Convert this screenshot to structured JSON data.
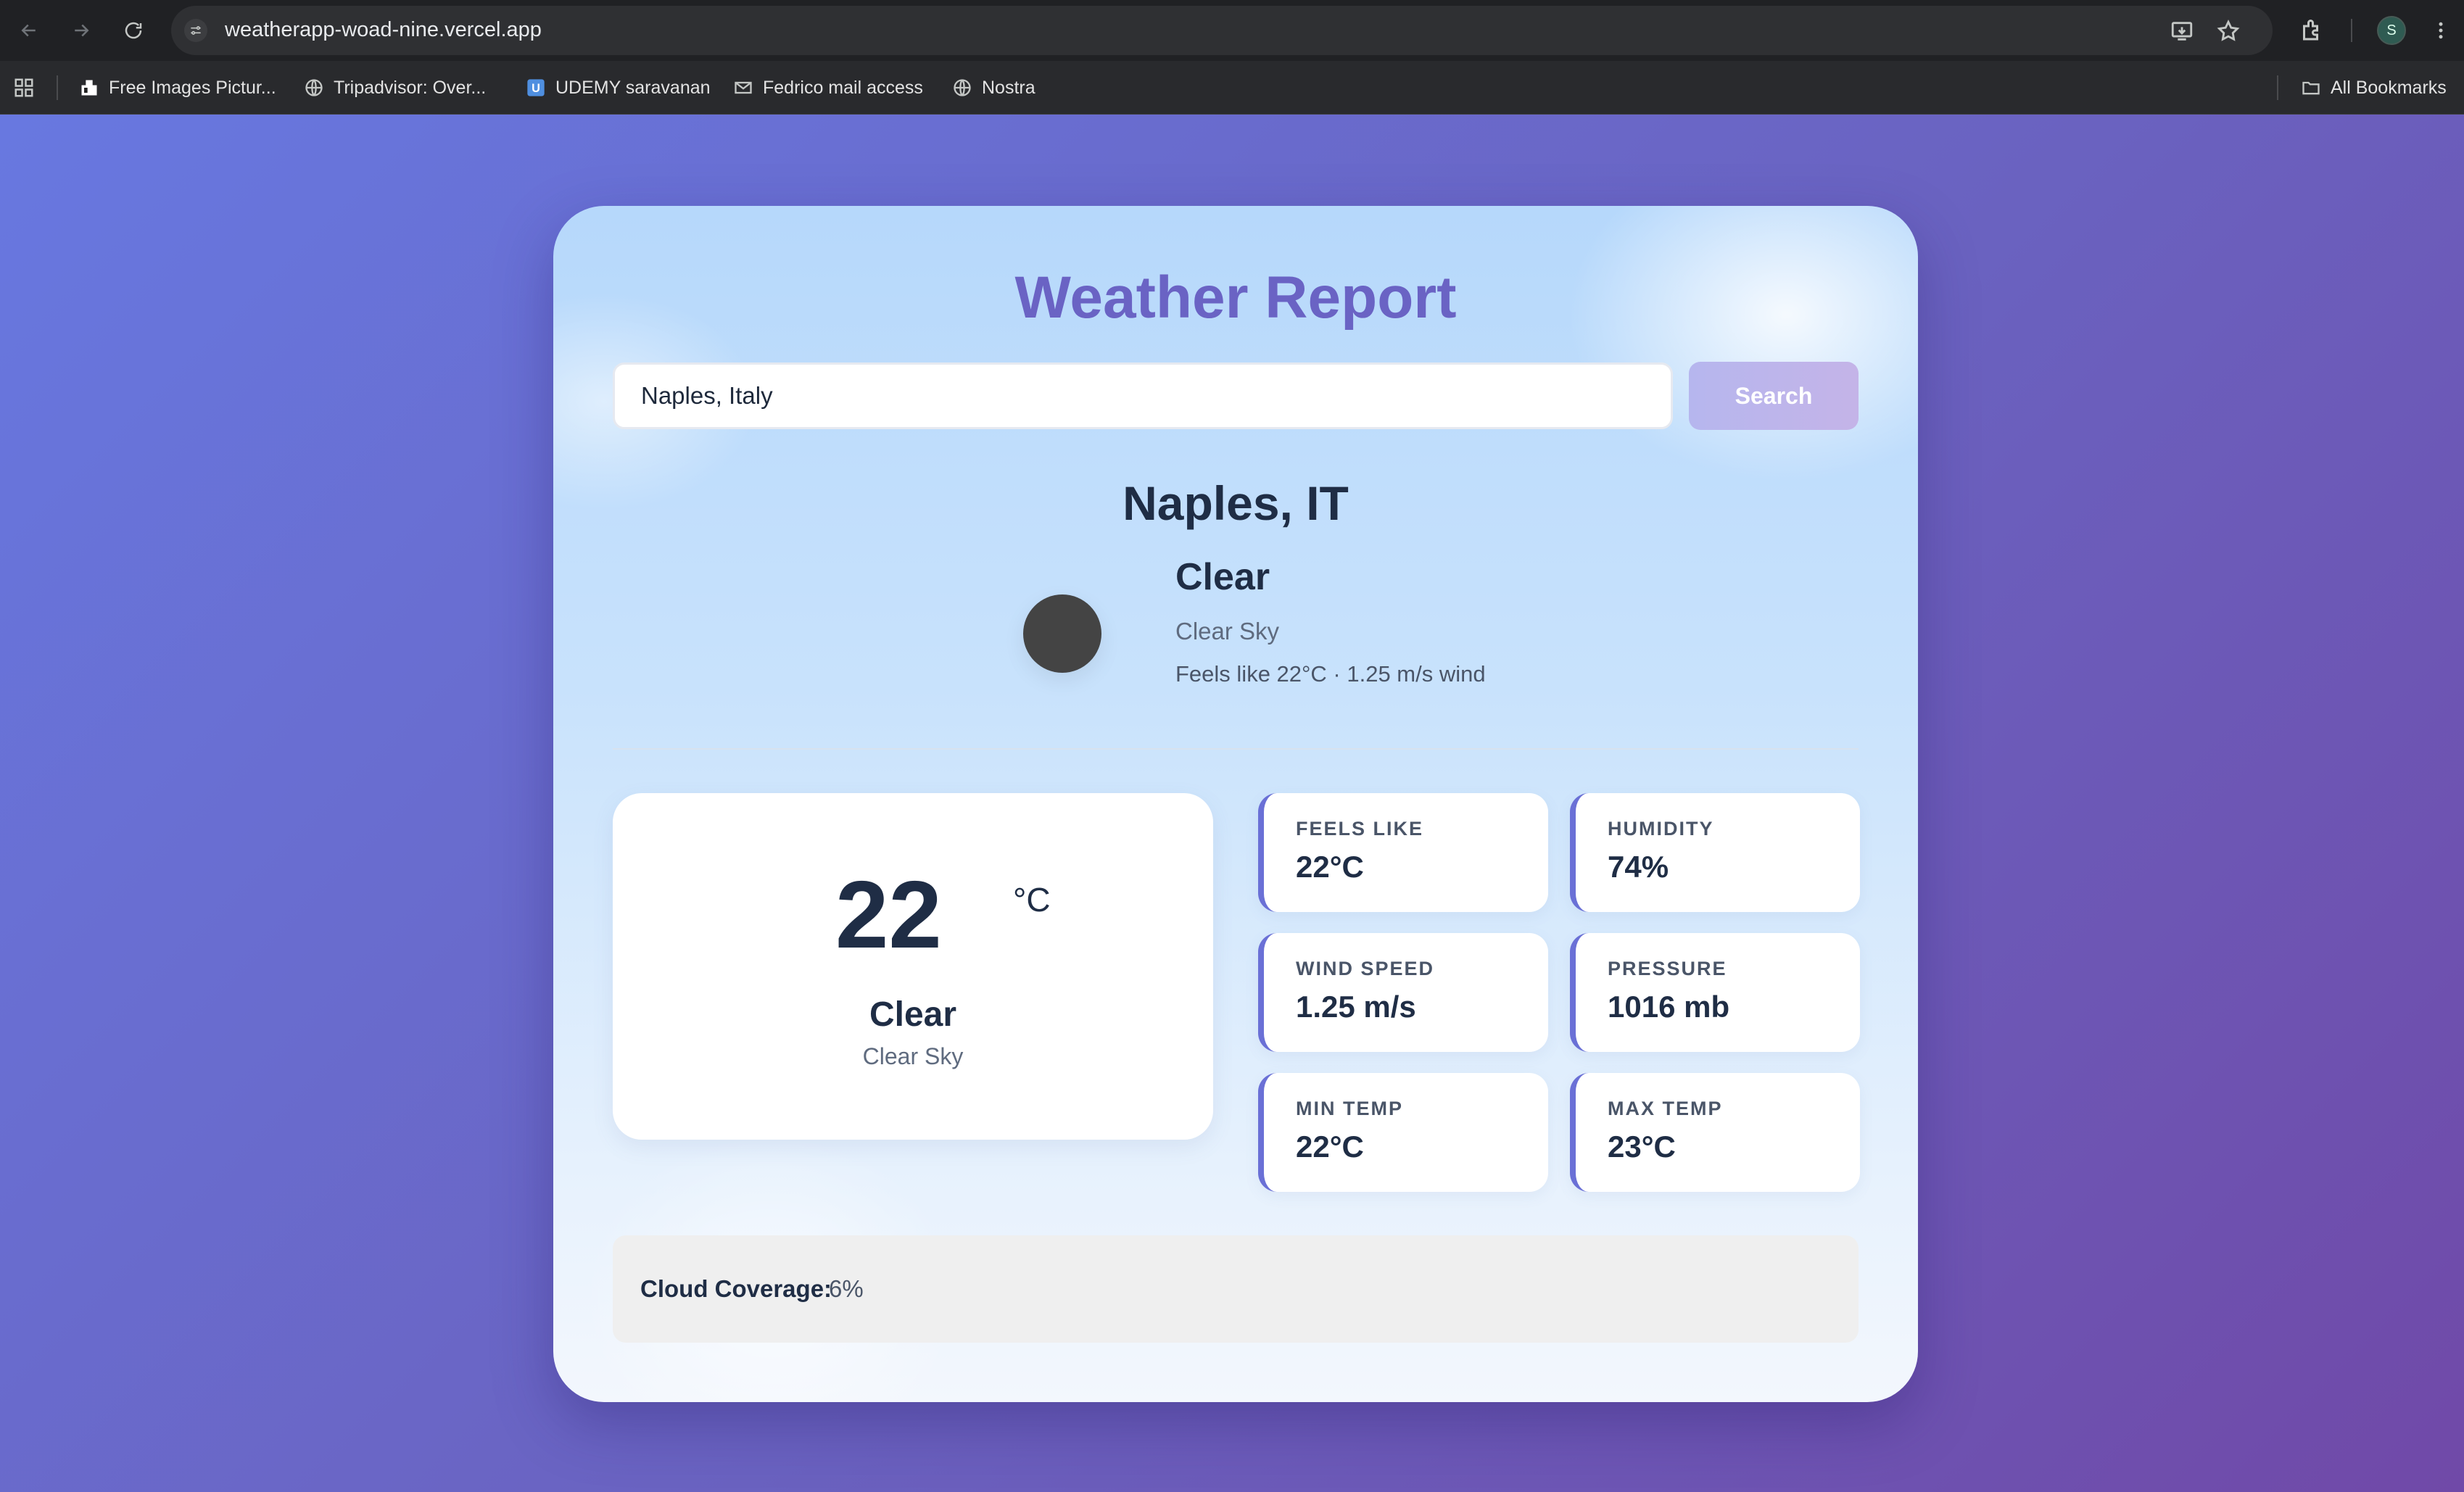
{
  "browser": {
    "url": "weatherapp-woad-nine.vercel.app",
    "profile_initial": "S",
    "bookmarks": [
      {
        "label": "Free Images Pictur...",
        "icon": "image-site-icon"
      },
      {
        "label": "Tripadvisor: Over...",
        "icon": "globe-icon"
      },
      {
        "label": "UDEMY saravanan",
        "icon": "udemy-icon"
      },
      {
        "label": "Fedrico mail access",
        "icon": "mail-icon"
      },
      {
        "label": "Nostra",
        "icon": "globe-icon"
      }
    ],
    "all_bookmarks_label": "All Bookmarks"
  },
  "app": {
    "title": "Weather Report",
    "search": {
      "value": "Naples, Italy",
      "button_label": "Search"
    },
    "city": "Naples, IT",
    "condition": {
      "main": "Clear",
      "description": "Clear Sky",
      "extra": "Feels like 22°C · 1.25 m/s wind"
    },
    "temperature": {
      "value": "22",
      "unit": "°C",
      "condition": "Clear",
      "description": "Clear Sky"
    },
    "stats": [
      {
        "label": "FEELS LIKE",
        "value": "22°C"
      },
      {
        "label": "HUMIDITY",
        "value": "74%"
      },
      {
        "label": "WIND SPEED",
        "value": "1.25 m/s"
      },
      {
        "label": "PRESSURE",
        "value": "1016 mb"
      },
      {
        "label": "MIN TEMP",
        "value": "22°C"
      },
      {
        "label": "MAX TEMP",
        "value": "23°C"
      }
    ],
    "cloud_coverage": {
      "label": "Cloud Coverage:",
      "value": "6%"
    }
  },
  "colors": {
    "accent": "#6a63c4",
    "stat_border": "#6a70d6",
    "text_dark": "#1f2d45"
  }
}
